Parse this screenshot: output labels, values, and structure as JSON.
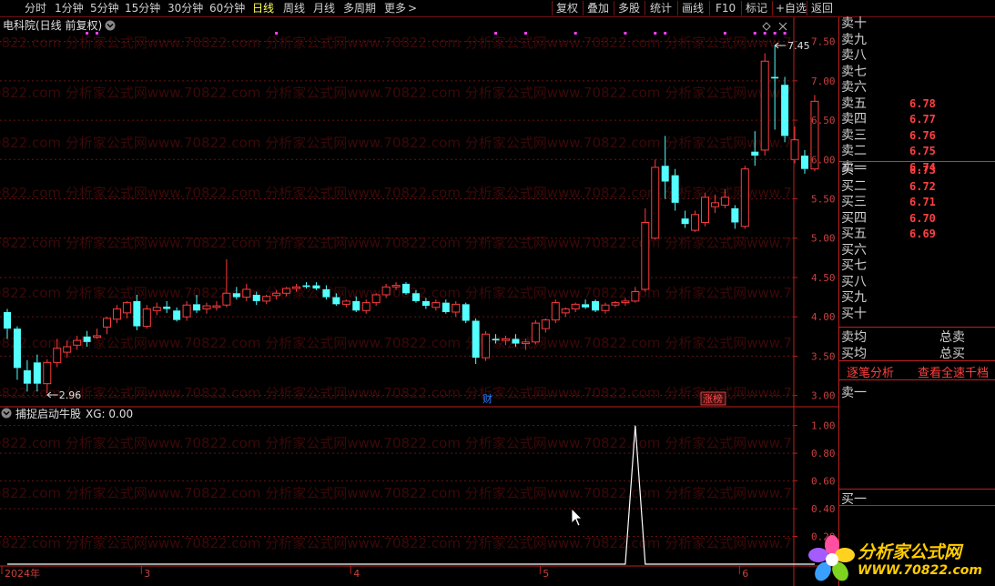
{
  "toolbar": {
    "periods": [
      "分时",
      "1分钟",
      "5分钟",
      "15分钟",
      "30分钟",
      "60分钟",
      "日线",
      "周线",
      "月线",
      "多周期",
      "更多"
    ],
    "active_period": "日线",
    "more_arrow": ">",
    "right_buttons": [
      "复权",
      "叠加",
      "多股",
      "统计",
      "画线",
      "F10",
      "标记",
      "+自选",
      "返回"
    ]
  },
  "main_panel": {
    "title": "电科院(日线 前复权)",
    "collapse_icon": "chevron-down-circle-icon",
    "settings_icon": "diamond-icon",
    "close_icon": "close-icon",
    "high_label": "7.45",
    "low_label": "2.96",
    "event_tags": [
      {
        "label": "财",
        "color": "#2a7fff"
      },
      {
        "label": "涨榜",
        "color": "#ff5050"
      }
    ]
  },
  "indicator_panel": {
    "title": "捕捉启动牛股",
    "value_label": "XG: 0.00"
  },
  "watermark": "0822.com 分析家公式网www.70822.com 分析家公式网www.70822.com 分析家公式网www.70822.com 分析家公式网www.7",
  "chart_data": [
    {
      "type": "candlestick",
      "title": "电科院(日线 前复权)",
      "ylim": [
        2.88,
        7.6
      ],
      "y_ticks": [
        3.0,
        3.5,
        4.0,
        4.5,
        5.0,
        5.5,
        6.0,
        6.5,
        7.0,
        7.5
      ],
      "y_tick_labels": [
        "3.00",
        "3.50",
        "4.00",
        "4.50",
        "5.00",
        "5.50",
        "6.00",
        "6.50",
        "7.00",
        "7.50"
      ],
      "x_labels": [
        {
          "label": "2024年",
          "index": 0
        },
        {
          "label": "3",
          "index": 14
        },
        {
          "label": "4",
          "index": 35
        },
        {
          "label": "5",
          "index": 54
        },
        {
          "label": "6",
          "index": 74
        }
      ],
      "up_color": "#ff3c3c",
      "down_color": "#54ffff",
      "ohlc": [
        [
          4.06,
          4.1,
          3.72,
          3.85
        ],
        [
          3.85,
          3.88,
          3.2,
          3.35
        ],
        [
          3.32,
          3.45,
          3.05,
          3.15
        ],
        [
          3.42,
          3.52,
          3.05,
          3.15
        ],
        [
          3.15,
          3.46,
          3.03,
          3.42
        ],
        [
          3.42,
          3.72,
          3.36,
          3.6
        ],
        [
          3.55,
          3.7,
          3.48,
          3.62
        ],
        [
          3.64,
          3.76,
          3.58,
          3.7
        ],
        [
          3.75,
          3.82,
          3.62,
          3.68
        ],
        [
          3.74,
          3.85,
          3.72,
          3.76
        ],
        [
          3.87,
          4.0,
          3.78,
          3.98
        ],
        [
          3.97,
          4.15,
          3.92,
          4.1
        ],
        [
          4.05,
          4.2,
          3.98,
          4.18
        ],
        [
          4.2,
          4.28,
          3.83,
          3.88
        ],
        [
          3.88,
          4.15,
          3.85,
          4.1
        ],
        [
          4.08,
          4.18,
          4.02,
          4.12
        ],
        [
          4.13,
          4.2,
          4.05,
          4.1
        ],
        [
          4.08,
          4.12,
          3.94,
          3.96
        ],
        [
          4.0,
          4.2,
          3.95,
          4.15
        ],
        [
          4.16,
          4.28,
          4.05,
          4.08
        ],
        [
          4.1,
          4.18,
          4.04,
          4.14
        ],
        [
          4.12,
          4.2,
          4.08,
          4.14
        ],
        [
          4.15,
          4.73,
          4.12,
          4.3
        ],
        [
          4.3,
          4.38,
          4.22,
          4.25
        ],
        [
          4.25,
          4.42,
          4.2,
          4.35
        ],
        [
          4.28,
          4.32,
          4.15,
          4.2
        ],
        [
          4.2,
          4.28,
          4.16,
          4.26
        ],
        [
          4.27,
          4.34,
          4.22,
          4.3
        ],
        [
          4.3,
          4.38,
          4.26,
          4.36
        ],
        [
          4.36,
          4.42,
          4.32,
          4.38
        ],
        [
          4.4,
          4.44,
          4.36,
          4.38
        ],
        [
          4.4,
          4.44,
          4.34,
          4.36
        ],
        [
          4.35,
          4.4,
          4.22,
          4.25
        ],
        [
          4.25,
          4.3,
          4.14,
          4.16
        ],
        [
          4.16,
          4.22,
          4.12,
          4.2
        ],
        [
          4.2,
          4.26,
          4.06,
          4.08
        ],
        [
          4.08,
          4.22,
          4.04,
          4.18
        ],
        [
          4.18,
          4.3,
          4.14,
          4.28
        ],
        [
          4.28,
          4.42,
          4.24,
          4.38
        ],
        [
          4.38,
          4.44,
          4.34,
          4.4
        ],
        [
          4.42,
          4.44,
          4.28,
          4.3
        ],
        [
          4.3,
          4.34,
          4.18,
          4.2
        ],
        [
          4.2,
          4.24,
          4.1,
          4.14
        ],
        [
          4.12,
          4.22,
          4.08,
          4.18
        ],
        [
          4.18,
          4.22,
          4.04,
          4.06
        ],
        [
          4.06,
          4.2,
          4.0,
          4.16
        ],
        [
          4.16,
          4.18,
          3.92,
          3.95
        ],
        [
          3.95,
          3.98,
          3.4,
          3.48
        ],
        [
          3.48,
          3.82,
          3.44,
          3.78
        ],
        [
          3.72,
          3.78,
          3.66,
          3.7
        ],
        [
          3.7,
          3.76,
          3.64,
          3.72
        ],
        [
          3.72,
          3.78,
          3.62,
          3.66
        ],
        [
          3.66,
          3.72,
          3.58,
          3.68
        ],
        [
          3.68,
          3.96,
          3.65,
          3.92
        ],
        [
          3.85,
          3.98,
          3.8,
          3.96
        ],
        [
          3.96,
          4.22,
          3.92,
          4.18
        ],
        [
          4.05,
          4.12,
          4.0,
          4.1
        ],
        [
          4.1,
          4.18,
          4.06,
          4.16
        ],
        [
          4.16,
          4.22,
          4.1,
          4.12
        ],
        [
          4.2,
          4.22,
          4.06,
          4.08
        ],
        [
          4.08,
          4.18,
          4.04,
          4.15
        ],
        [
          4.15,
          4.2,
          4.12,
          4.18
        ],
        [
          4.18,
          4.24,
          4.14,
          4.2
        ],
        [
          4.2,
          4.38,
          4.18,
          4.32
        ],
        [
          4.35,
          5.38,
          4.32,
          5.2
        ],
        [
          5.0,
          6.0,
          4.98,
          5.9
        ],
        [
          5.92,
          6.3,
          5.5,
          5.72
        ],
        [
          5.8,
          5.88,
          5.35,
          5.45
        ],
        [
          5.25,
          5.35,
          5.13,
          5.18
        ],
        [
          5.1,
          5.35,
          5.08,
          5.3
        ],
        [
          5.2,
          5.58,
          5.15,
          5.52
        ],
        [
          5.4,
          5.55,
          5.32,
          5.45
        ],
        [
          5.42,
          5.62,
          5.38,
          5.52
        ],
        [
          5.38,
          5.42,
          5.12,
          5.2
        ],
        [
          5.15,
          5.92,
          5.12,
          5.88
        ],
        [
          6.1,
          6.36,
          5.92,
          6.05
        ],
        [
          6.12,
          7.35,
          6.05,
          7.25
        ],
        [
          7.05,
          7.45,
          6.38,
          7.03
        ],
        [
          6.95,
          7.05,
          6.22,
          6.3
        ],
        [
          6.0,
          6.42,
          5.95,
          6.25
        ],
        [
          6.05,
          6.12,
          5.82,
          5.88
        ],
        [
          5.88,
          6.82,
          5.85,
          6.74
        ]
      ]
    },
    {
      "type": "line",
      "title": "捕捉启动牛股",
      "ylim": [
        0,
        1.05
      ],
      "y_ticks": [
        0.2,
        0.4,
        0.6,
        0.8,
        1.0
      ],
      "y_tick_labels": [
        "0.20",
        "0.40",
        "0.60",
        "0.80",
        "1.00"
      ],
      "series": [
        {
          "name": "XG",
          "spike_index": 63,
          "spike_value": 1.0,
          "baseline": 0
        }
      ]
    }
  ],
  "order_book": {
    "sell": [
      {
        "label": "卖十",
        "price": ""
      },
      {
        "label": "卖九",
        "price": ""
      },
      {
        "label": "卖八",
        "price": ""
      },
      {
        "label": "卖七",
        "price": ""
      },
      {
        "label": "卖六",
        "price": ""
      },
      {
        "label": "卖五",
        "price": "6.78"
      },
      {
        "label": "卖四",
        "price": "6.77"
      },
      {
        "label": "卖三",
        "price": "6.76"
      },
      {
        "label": "卖二",
        "price": "6.75"
      },
      {
        "label": "卖一",
        "price": "6.74"
      }
    ],
    "buy": [
      {
        "label": "买一",
        "price": "6.73"
      },
      {
        "label": "买二",
        "price": "6.72"
      },
      {
        "label": "买三",
        "price": "6.71"
      },
      {
        "label": "买四",
        "price": "6.70"
      },
      {
        "label": "买五",
        "price": "6.69"
      },
      {
        "label": "买六",
        "price": ""
      },
      {
        "label": "买七",
        "price": ""
      },
      {
        "label": "买八",
        "price": ""
      },
      {
        "label": "买九",
        "price": ""
      },
      {
        "label": "买十",
        "price": ""
      }
    ],
    "avg_sell": "卖均",
    "avg_buy": "买均",
    "total_sell": "总卖",
    "total_buy": "总买",
    "link_tick": "逐笔分析",
    "link_full": "查看全速千档",
    "queue_sell": "卖一",
    "queue_buy": "买一"
  },
  "logo": {
    "title": "分析家公式网",
    "url": "WWW.70822.com",
    "icon": "flower-logo-icon"
  }
}
